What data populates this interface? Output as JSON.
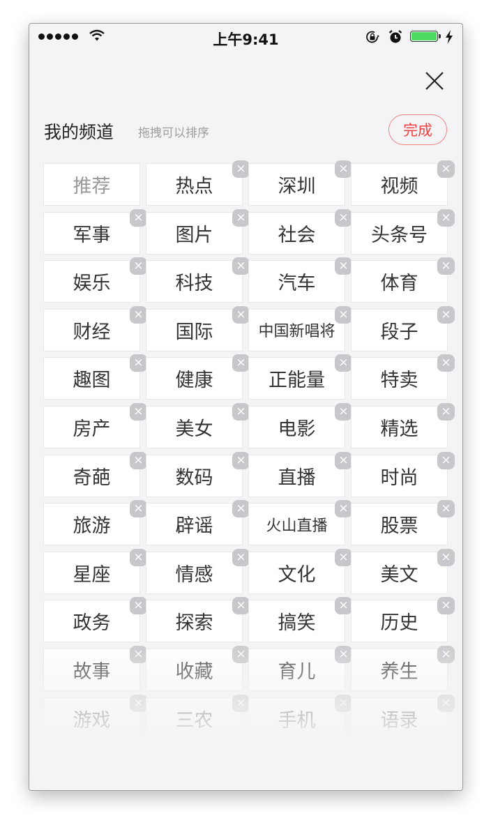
{
  "status_bar": {
    "time": "上午9:41",
    "signal_bars": 5,
    "icons": [
      "signal-dots-icon",
      "wifi-icon",
      "rotation-lock-icon",
      "alarm-icon",
      "battery-icon",
      "charging-bolt-icon"
    ],
    "battery_level": 1.0,
    "battery_color": "#4cd964"
  },
  "header": {
    "close_icon": "close-icon",
    "section_title": "我的频道",
    "section_hint": "拖拽可以排序",
    "done_label": "完成",
    "accent_color": "#f04242"
  },
  "channels": [
    {
      "label": "推荐",
      "removable": false
    },
    {
      "label": "热点",
      "removable": true
    },
    {
      "label": "深圳",
      "removable": true
    },
    {
      "label": "视频",
      "removable": true
    },
    {
      "label": "军事",
      "removable": true
    },
    {
      "label": "图片",
      "removable": true
    },
    {
      "label": "社会",
      "removable": true
    },
    {
      "label": "头条号",
      "removable": true
    },
    {
      "label": "娱乐",
      "removable": true
    },
    {
      "label": "科技",
      "removable": true
    },
    {
      "label": "汽车",
      "removable": true
    },
    {
      "label": "体育",
      "removable": true
    },
    {
      "label": "财经",
      "removable": true
    },
    {
      "label": "国际",
      "removable": true
    },
    {
      "label": "中国新唱将",
      "removable": true
    },
    {
      "label": "段子",
      "removable": true
    },
    {
      "label": "趣图",
      "removable": true
    },
    {
      "label": "健康",
      "removable": true
    },
    {
      "label": "正能量",
      "removable": true
    },
    {
      "label": "特卖",
      "removable": true
    },
    {
      "label": "房产",
      "removable": true
    },
    {
      "label": "美女",
      "removable": true
    },
    {
      "label": "电影",
      "removable": true
    },
    {
      "label": "精选",
      "removable": true
    },
    {
      "label": "奇葩",
      "removable": true
    },
    {
      "label": "数码",
      "removable": true
    },
    {
      "label": "直播",
      "removable": true
    },
    {
      "label": "时尚",
      "removable": true
    },
    {
      "label": "旅游",
      "removable": true
    },
    {
      "label": "辟谣",
      "removable": true
    },
    {
      "label": "火山直播",
      "removable": true
    },
    {
      "label": "股票",
      "removable": true
    },
    {
      "label": "星座",
      "removable": true
    },
    {
      "label": "情感",
      "removable": true
    },
    {
      "label": "文化",
      "removable": true
    },
    {
      "label": "美文",
      "removable": true
    },
    {
      "label": "政务",
      "removable": true
    },
    {
      "label": "探索",
      "removable": true
    },
    {
      "label": "搞笑",
      "removable": true
    },
    {
      "label": "历史",
      "removable": true
    },
    {
      "label": "故事",
      "removable": true
    },
    {
      "label": "收藏",
      "removable": true
    },
    {
      "label": "育儿",
      "removable": true
    },
    {
      "label": "养生",
      "removable": true
    },
    {
      "label": "游戏",
      "removable": true
    },
    {
      "label": "三农",
      "removable": true
    },
    {
      "label": "手机",
      "removable": true
    },
    {
      "label": "语录",
      "removable": true
    }
  ],
  "remove_glyph": "×"
}
